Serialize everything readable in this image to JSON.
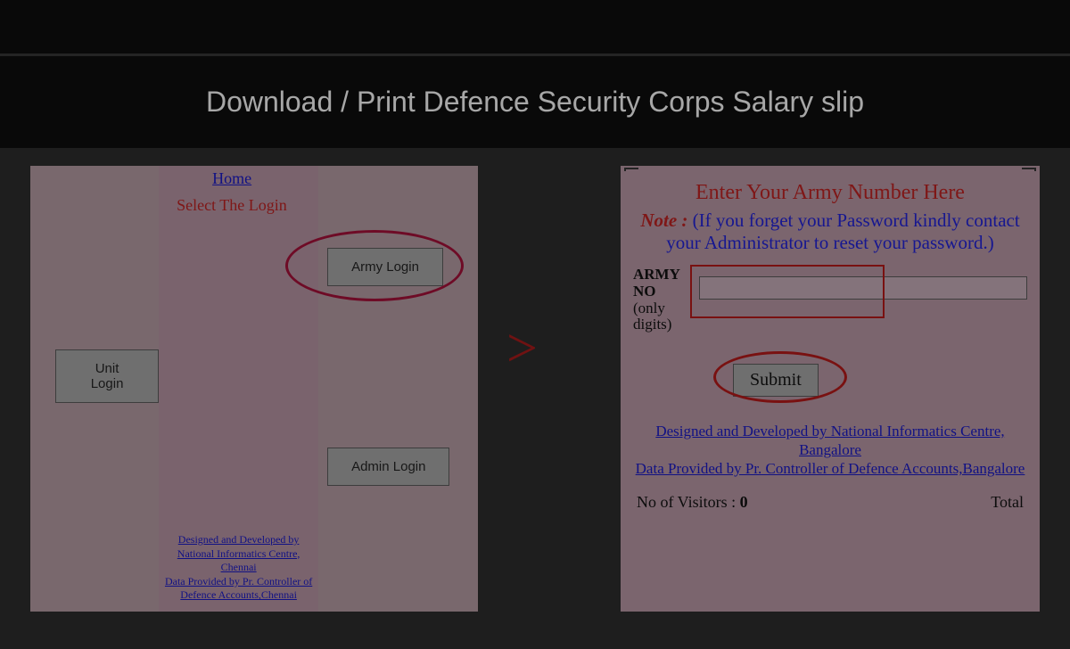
{
  "page": {
    "title": "Download / Print Defence Security Corps Salary slip"
  },
  "left_panel": {
    "home_link": "Home",
    "select_login": "Select The Login",
    "buttons": {
      "unit": "Unit Login",
      "army": "Army Login",
      "admin": "Admin Login"
    },
    "footer": {
      "line1": "Designed and Developed by National Informatics Centre, Chennai",
      "line2": "Data Provided by Pr. Controller of Defence Accounts,Chennai"
    }
  },
  "arrow": ">",
  "right_panel": {
    "header": "Enter Your Army Number Here",
    "note_label": "Note :",
    "note_text": "(If you forget your Password kindly contact your Administrator to reset your password.)",
    "army_no_label_bold": "ARMY NO",
    "army_no_label_hint": "(only digits)",
    "army_no_value": "",
    "submit": "Submit",
    "footer": {
      "line1": "Designed and Developed by National Informatics Centre, Bangalore",
      "line2": "Data Provided by Pr. Controller of Defence Accounts,Bangalore"
    },
    "visitors_label": "No of Visitors :",
    "visitors_count": "0",
    "total_label": "Total"
  }
}
